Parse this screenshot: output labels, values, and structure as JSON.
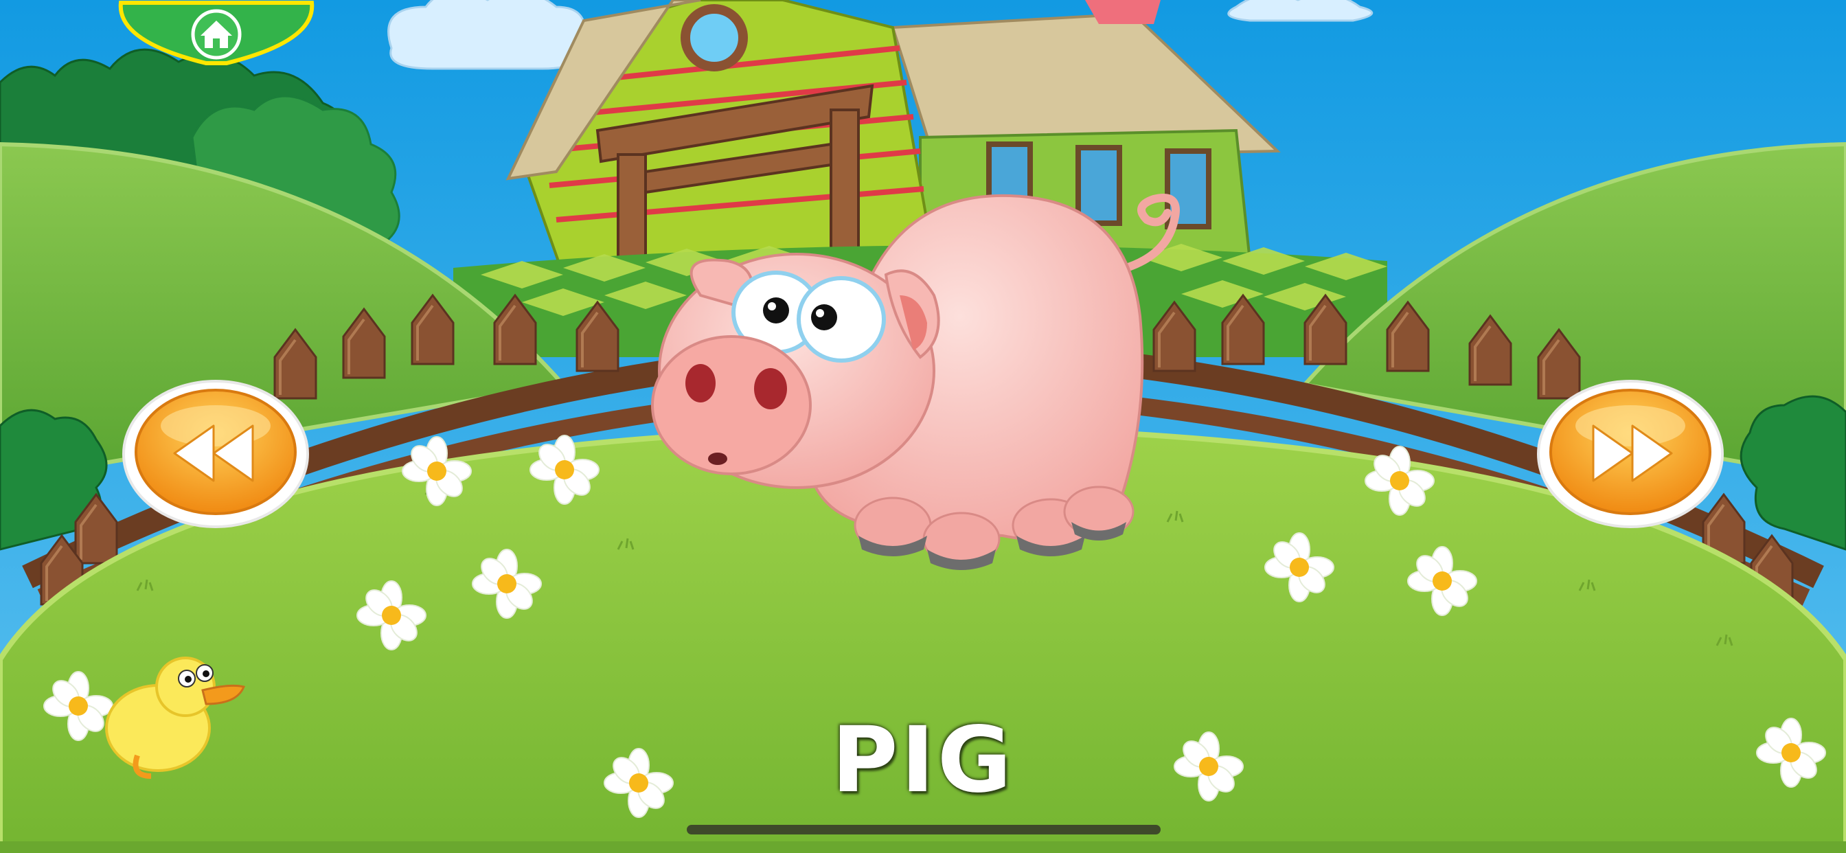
{
  "app": {
    "screen": "animal-flashcard",
    "animal_name": "PIG"
  },
  "controls": {
    "home_icon": "home-icon",
    "prev_icon": "rewind-icon",
    "next_icon": "fast-forward-icon"
  },
  "colors": {
    "sky": "#1fa3e3",
    "grass": "#8cc63f",
    "hill": "#6fb43a",
    "home_button": "#33b34a",
    "home_button_border": "#ffe600",
    "nav_button": "#f7a21b",
    "pig": "#f7b8b3",
    "fence": "#8a5232"
  }
}
